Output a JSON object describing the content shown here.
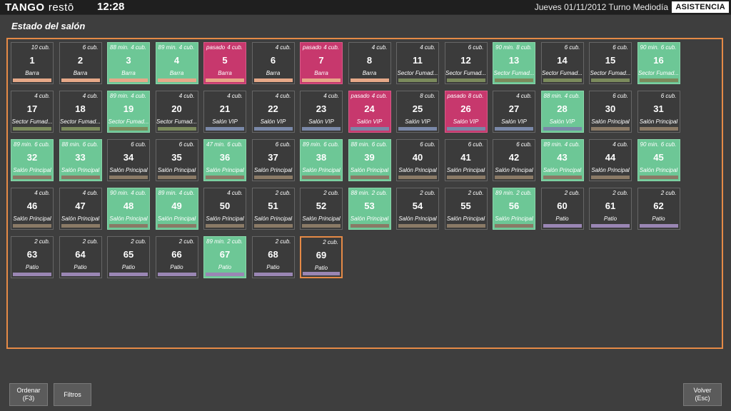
{
  "header": {
    "logo_bold": "TANGO",
    "logo_light": "restō",
    "time": "12:28",
    "date_shift": "Jueves 01/11/2012 Turno Mediodía",
    "mode_badge": "ASISTENCIA"
  },
  "page_title": "Estado del salón",
  "colors": {
    "accent": "#e58a46",
    "free": "#3b3b3b",
    "occupied": "#6dc796",
    "overdue": "#c7386d",
    "zone_barra": "#e6a888",
    "zone_sector_fumadores": "#7b8a5c",
    "zone_salon_vip": "#7a88a8",
    "zone_salon_principal": "#8a7a66",
    "zone_patio": "#9a86b4"
  },
  "tables": [
    {
      "num": "1",
      "cub": "10 cub.",
      "time": "",
      "zone": "Barra",
      "status": "free",
      "zone_key": "barra"
    },
    {
      "num": "2",
      "cub": "6 cub.",
      "time": "",
      "zone": "Barra",
      "status": "free",
      "zone_key": "barra"
    },
    {
      "num": "3",
      "cub": "4 cub.",
      "time": "88 min.",
      "zone": "Barra",
      "status": "occupied",
      "zone_key": "barra"
    },
    {
      "num": "4",
      "cub": "4 cub.",
      "time": "89 min.",
      "zone": "Barra",
      "status": "occupied",
      "zone_key": "barra"
    },
    {
      "num": "5",
      "cub": "4 cub.",
      "time": "pasado",
      "zone": "Barra",
      "status": "overdue",
      "zone_key": "barra"
    },
    {
      "num": "6",
      "cub": "4 cub.",
      "time": "",
      "zone": "Barra",
      "status": "free",
      "zone_key": "barra"
    },
    {
      "num": "7",
      "cub": "4 cub.",
      "time": "pasado",
      "zone": "Barra",
      "status": "overdue",
      "zone_key": "barra"
    },
    {
      "num": "8",
      "cub": "4 cub.",
      "time": "",
      "zone": "Barra",
      "status": "free",
      "zone_key": "barra"
    },
    {
      "num": "11",
      "cub": "4 cub.",
      "time": "",
      "zone": "Sector Fumad...",
      "status": "free",
      "zone_key": "sector_fumadores"
    },
    {
      "num": "12",
      "cub": "6 cub.",
      "time": "",
      "zone": "Sector Fumad...",
      "status": "free",
      "zone_key": "sector_fumadores"
    },
    {
      "num": "13",
      "cub": "8 cub.",
      "time": "90 min.",
      "zone": "Sector Fumad...",
      "status": "occupied",
      "zone_key": "sector_fumadores"
    },
    {
      "num": "14",
      "cub": "6 cub.",
      "time": "",
      "zone": "Sector Fumad...",
      "status": "free",
      "zone_key": "sector_fumadores"
    },
    {
      "num": "15",
      "cub": "6 cub.",
      "time": "",
      "zone": "Sector Fumad...",
      "status": "free",
      "zone_key": "sector_fumadores"
    },
    {
      "num": "16",
      "cub": "6 cub.",
      "time": "90 min.",
      "zone": "Sector Fumad...",
      "status": "occupied",
      "zone_key": "sector_fumadores"
    },
    {
      "num": "17",
      "cub": "4 cub.",
      "time": "",
      "zone": "Sector Fumad...",
      "status": "free",
      "zone_key": "sector_fumadores"
    },
    {
      "num": "18",
      "cub": "4 cub.",
      "time": "",
      "zone": "Sector Fumad...",
      "status": "free",
      "zone_key": "sector_fumadores"
    },
    {
      "num": "19",
      "cub": "4 cub.",
      "time": "89 min.",
      "zone": "Sector Fumad...",
      "status": "occupied",
      "zone_key": "sector_fumadores"
    },
    {
      "num": "20",
      "cub": "4 cub.",
      "time": "",
      "zone": "Sector Fumad...",
      "status": "free",
      "zone_key": "sector_fumadores"
    },
    {
      "num": "21",
      "cub": "4 cub.",
      "time": "",
      "zone": "Salón VIP",
      "status": "free",
      "zone_key": "salon_vip"
    },
    {
      "num": "22",
      "cub": "4 cub.",
      "time": "",
      "zone": "Salón VIP",
      "status": "free",
      "zone_key": "salon_vip"
    },
    {
      "num": "23",
      "cub": "4 cub.",
      "time": "",
      "zone": "Salón VIP",
      "status": "free",
      "zone_key": "salon_vip"
    },
    {
      "num": "24",
      "cub": "4 cub.",
      "time": "pasado",
      "zone": "Salón VIP",
      "status": "overdue",
      "zone_key": "salon_vip"
    },
    {
      "num": "25",
      "cub": "8 cub.",
      "time": "",
      "zone": "Salón VIP",
      "status": "free",
      "zone_key": "salon_vip"
    },
    {
      "num": "26",
      "cub": "8 cub.",
      "time": "pasado",
      "zone": "Salón VIP",
      "status": "overdue",
      "zone_key": "salon_vip"
    },
    {
      "num": "27",
      "cub": "4 cub.",
      "time": "",
      "zone": "Salón VIP",
      "status": "free",
      "zone_key": "salon_vip"
    },
    {
      "num": "28",
      "cub": "4 cub.",
      "time": "88 min.",
      "zone": "Salón VIP",
      "status": "occupied",
      "zone_key": "salon_vip"
    },
    {
      "num": "30",
      "cub": "6 cub.",
      "time": "",
      "zone": "Salón Principal",
      "status": "free",
      "zone_key": "salon_principal"
    },
    {
      "num": "31",
      "cub": "6 cub.",
      "time": "",
      "zone": "Salón Principal",
      "status": "free",
      "zone_key": "salon_principal"
    },
    {
      "num": "32",
      "cub": "6 cub.",
      "time": "89 min.",
      "zone": "Salón Principal",
      "status": "occupied",
      "zone_key": "salon_principal"
    },
    {
      "num": "33",
      "cub": "6 cub.",
      "time": "88 min.",
      "zone": "Salón Principal",
      "status": "occupied",
      "zone_key": "salon_principal"
    },
    {
      "num": "34",
      "cub": "6 cub.",
      "time": "",
      "zone": "Salón Principal",
      "status": "free",
      "zone_key": "salon_principal"
    },
    {
      "num": "35",
      "cub": "6 cub.",
      "time": "",
      "zone": "Salón Principal",
      "status": "free",
      "zone_key": "salon_principal"
    },
    {
      "num": "36",
      "cub": "6 cub.",
      "time": "47 min.",
      "zone": "Salón Principal",
      "status": "occupied",
      "zone_key": "salon_principal"
    },
    {
      "num": "37",
      "cub": "6 cub.",
      "time": "",
      "zone": "Salón Principal",
      "status": "free",
      "zone_key": "salon_principal"
    },
    {
      "num": "38",
      "cub": "6 cub.",
      "time": "89 min.",
      "zone": "Salón Principal",
      "status": "occupied",
      "zone_key": "salon_principal"
    },
    {
      "num": "39",
      "cub": "6 cub.",
      "time": "88 min.",
      "zone": "Salón Principal",
      "status": "occupied",
      "zone_key": "salon_principal"
    },
    {
      "num": "40",
      "cub": "6 cub.",
      "time": "",
      "zone": "Salón Principal",
      "status": "free",
      "zone_key": "salon_principal"
    },
    {
      "num": "41",
      "cub": "6 cub.",
      "time": "",
      "zone": "Salón Principal",
      "status": "free",
      "zone_key": "salon_principal"
    },
    {
      "num": "42",
      "cub": "6 cub.",
      "time": "",
      "zone": "Salón Principal",
      "status": "free",
      "zone_key": "salon_principal"
    },
    {
      "num": "43",
      "cub": "4 cub.",
      "time": "89 min.",
      "zone": "Salón Principal",
      "status": "occupied",
      "zone_key": "salon_principal"
    },
    {
      "num": "44",
      "cub": "4 cub.",
      "time": "",
      "zone": "Salón Principal",
      "status": "free",
      "zone_key": "salon_principal"
    },
    {
      "num": "45",
      "cub": "6 cub.",
      "time": "90 min.",
      "zone": "Salón Principal",
      "status": "occupied",
      "zone_key": "salon_principal"
    },
    {
      "num": "46",
      "cub": "4 cub.",
      "time": "",
      "zone": "Salón Principal",
      "status": "free",
      "zone_key": "salon_principal"
    },
    {
      "num": "47",
      "cub": "4 cub.",
      "time": "",
      "zone": "Salón Principal",
      "status": "free",
      "zone_key": "salon_principal"
    },
    {
      "num": "48",
      "cub": "4 cub.",
      "time": "90 min.",
      "zone": "Salón Principal",
      "status": "occupied",
      "zone_key": "salon_principal"
    },
    {
      "num": "49",
      "cub": "4 cub.",
      "time": "89 min.",
      "zone": "Salón Principal",
      "status": "occupied",
      "zone_key": "salon_principal"
    },
    {
      "num": "50",
      "cub": "4 cub.",
      "time": "",
      "zone": "Salón Principal",
      "status": "free",
      "zone_key": "salon_principal"
    },
    {
      "num": "51",
      "cub": "2 cub.",
      "time": "",
      "zone": "Salón Principal",
      "status": "free",
      "zone_key": "salon_principal"
    },
    {
      "num": "52",
      "cub": "2 cub.",
      "time": "",
      "zone": "Salón Principal",
      "status": "free",
      "zone_key": "salon_principal"
    },
    {
      "num": "53",
      "cub": "2 cub.",
      "time": "88 min.",
      "zone": "Salón Principal",
      "status": "occupied",
      "zone_key": "salon_principal"
    },
    {
      "num": "54",
      "cub": "2 cub.",
      "time": "",
      "zone": "Salón Principal",
      "status": "free",
      "zone_key": "salon_principal"
    },
    {
      "num": "55",
      "cub": "2 cub.",
      "time": "",
      "zone": "Salón Principal",
      "status": "free",
      "zone_key": "salon_principal"
    },
    {
      "num": "56",
      "cub": "2 cub.",
      "time": "89 min.",
      "zone": "Salón Principal",
      "status": "occupied",
      "zone_key": "salon_principal"
    },
    {
      "num": "60",
      "cub": "2 cub.",
      "time": "",
      "zone": "Patio",
      "status": "free",
      "zone_key": "patio"
    },
    {
      "num": "61",
      "cub": "2 cub.",
      "time": "",
      "zone": "Patio",
      "status": "free",
      "zone_key": "patio"
    },
    {
      "num": "62",
      "cub": "2 cub.",
      "time": "",
      "zone": "Patio",
      "status": "free",
      "zone_key": "patio"
    },
    {
      "num": "63",
      "cub": "2 cub.",
      "time": "",
      "zone": "Patio",
      "status": "free",
      "zone_key": "patio"
    },
    {
      "num": "64",
      "cub": "2 cub.",
      "time": "",
      "zone": "Patio",
      "status": "free",
      "zone_key": "patio"
    },
    {
      "num": "65",
      "cub": "2 cub.",
      "time": "",
      "zone": "Patio",
      "status": "free",
      "zone_key": "patio"
    },
    {
      "num": "66",
      "cub": "2 cub.",
      "time": "",
      "zone": "Patio",
      "status": "free",
      "zone_key": "patio"
    },
    {
      "num": "67",
      "cub": "2 cub.",
      "time": "89 min.",
      "zone": "Patio",
      "status": "occupied",
      "zone_key": "patio"
    },
    {
      "num": "68",
      "cub": "2 cub.",
      "time": "",
      "zone": "Patio",
      "status": "free",
      "zone_key": "patio"
    },
    {
      "num": "69",
      "cub": "2 cub.",
      "time": "",
      "zone": "Patio",
      "status": "free",
      "zone_key": "patio",
      "selected": true
    }
  ],
  "buttons": {
    "ordenar_line1": "Ordenar",
    "ordenar_line2": "(F3)",
    "filtros": "Filtros",
    "volver_line1": "Volver",
    "volver_line2": "(Esc)"
  }
}
